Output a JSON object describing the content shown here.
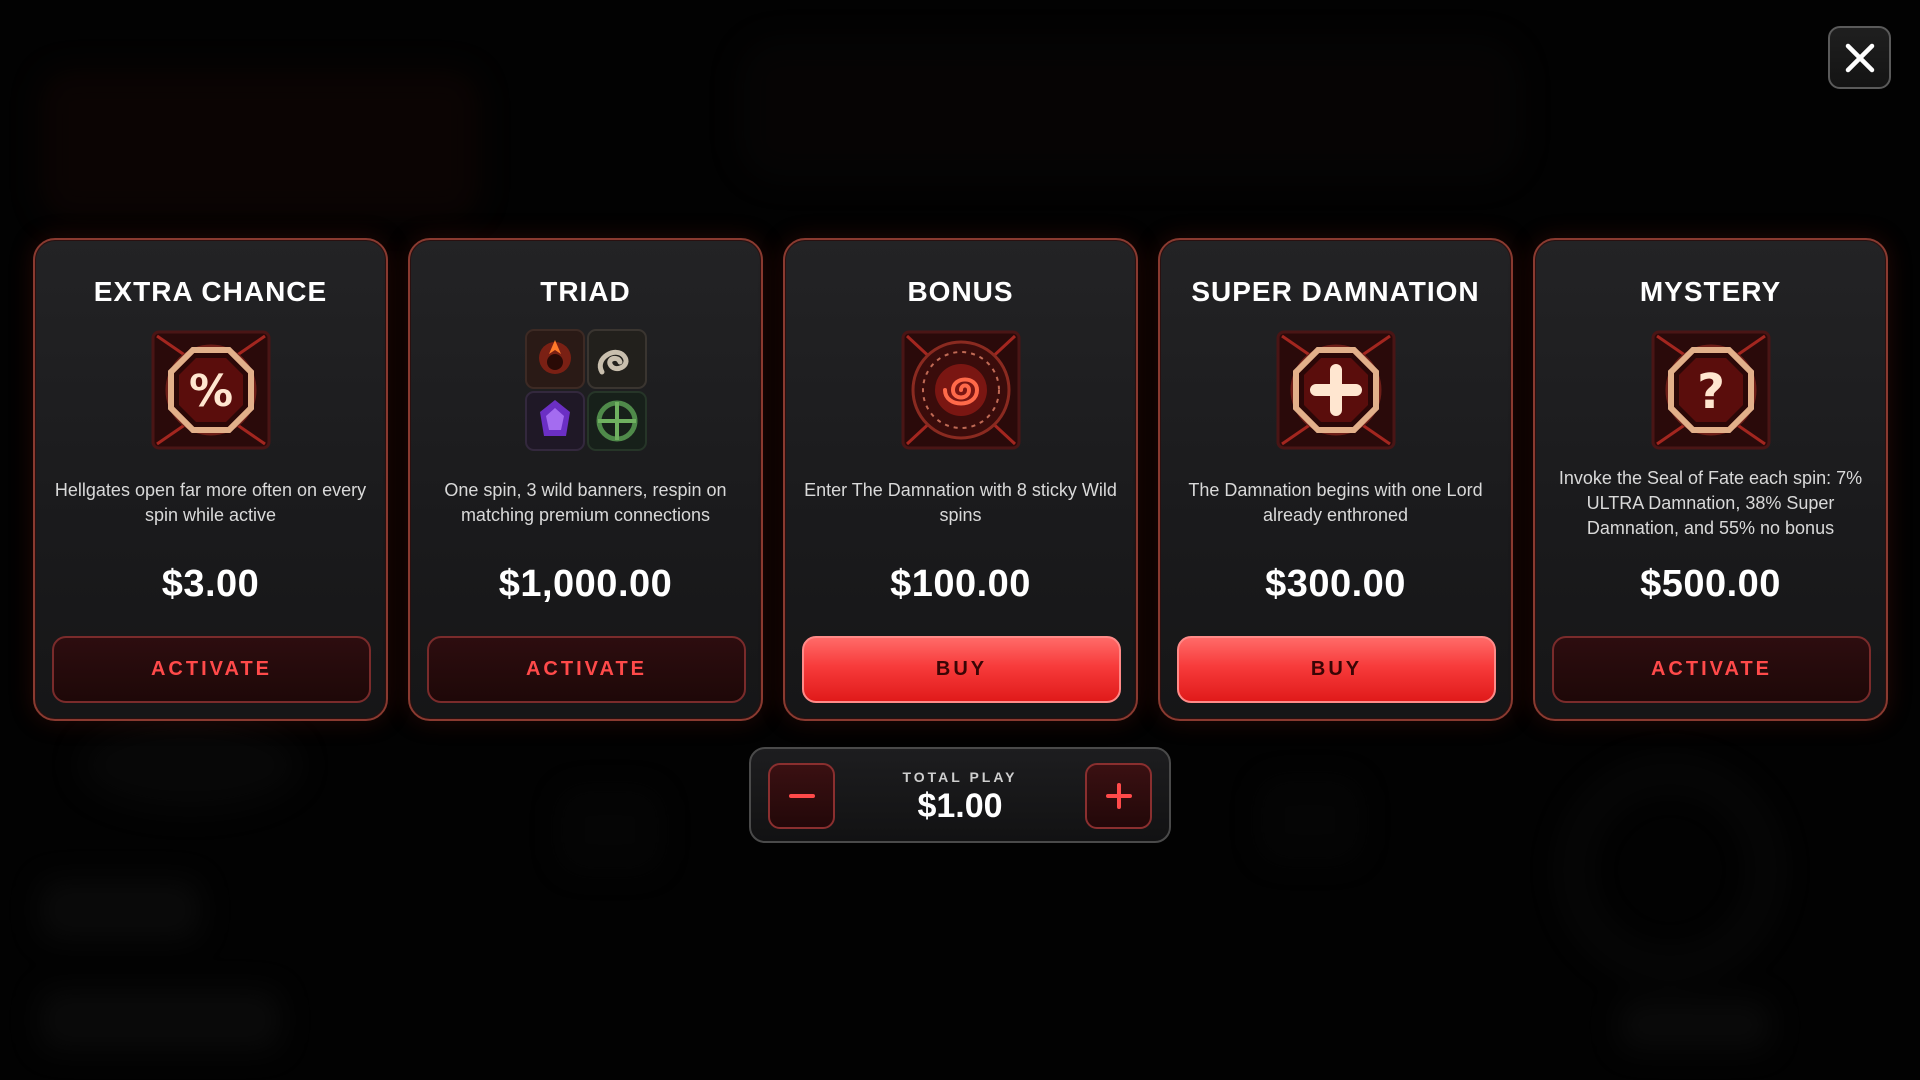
{
  "close_button": {
    "icon": "close-icon"
  },
  "cards": [
    {
      "title": "EXTRA CHANCE",
      "icon": "percent-seal-icon",
      "description": "Hellgates open far more often on every spin while active",
      "price": "$3.00",
      "button_label": "ACTIVATE",
      "button_style": "activate"
    },
    {
      "title": "TRIAD",
      "icon": "triad-symbols-icon",
      "description": "One spin, 3 wild banners, respin on matching premium connections",
      "price": "$1,000.00",
      "button_label": "ACTIVATE",
      "button_style": "activate"
    },
    {
      "title": "BONUS",
      "icon": "rune-spiral-icon",
      "description": "Enter The Damnation with 8 sticky Wild spins",
      "price": "$100.00",
      "button_label": "BUY",
      "button_style": "buy"
    },
    {
      "title": "SUPER DAMNATION",
      "icon": "plus-seal-icon",
      "description": "The Damnation begins with one Lord already enthroned",
      "price": "$300.00",
      "button_label": "BUY",
      "button_style": "buy"
    },
    {
      "title": "MYSTERY",
      "icon": "question-seal-icon",
      "description": "Invoke the Seal of Fate each spin: 7% ULTRA Damnation, 38% Super Damnation, and 55% no bonus",
      "price": "$500.00",
      "button_label": "ACTIVATE",
      "button_style": "activate"
    }
  ],
  "total_play": {
    "label": "TOTAL PLAY",
    "value": "$1.00",
    "decrease_icon": "minus-icon",
    "increase_icon": "plus-icon"
  },
  "colors": {
    "accent_red": "#ff4a4a",
    "buy_button": "#f73b3b",
    "card_border": "#8a3a30",
    "background": "#050505"
  }
}
